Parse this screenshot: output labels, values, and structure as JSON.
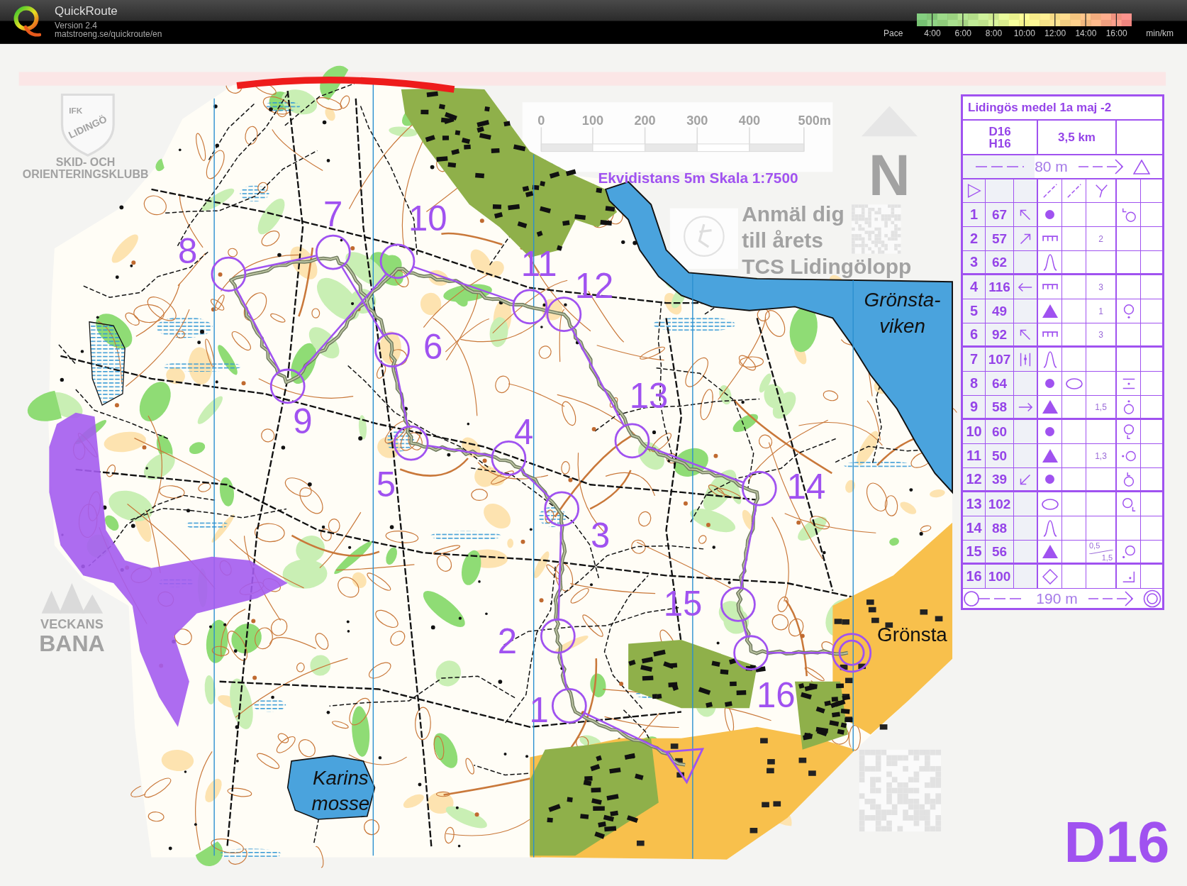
{
  "app_header": {
    "title": "QuickRoute",
    "version": "Version 2.4",
    "url": "matstroeng.se/quickroute/en"
  },
  "pace_legend": {
    "label": "Pace",
    "ticks": [
      "4:00",
      "6:00",
      "8:00",
      "10:00",
      "12:00",
      "14:00",
      "16:00"
    ],
    "unit": "min/km"
  },
  "map": {
    "faded_print": {
      "club_logo": [
        "IFK",
        "LIDINGÖ"
      ],
      "club_name": [
        "SKID- OCH",
        "ORIENTERINGSKLUBB"
      ],
      "scale_bar": [
        "0",
        "100",
        "200",
        "300",
        "400",
        "500m"
      ],
      "north_label": "N",
      "promo": [
        "Anmäl dig",
        "till årets",
        "TCS Lidingölopp"
      ],
      "weekly_course_logo": [
        "VECKANS",
        "BANA"
      ]
    },
    "scale_note": "Ekvidistans 5m Skala 1:7500",
    "place_names": [
      {
        "kind": "water",
        "lines": [
          "Grönsta-",
          "viken"
        ]
      },
      {
        "kind": "settlement",
        "lines": [
          "Grönsta"
        ]
      },
      {
        "kind": "water",
        "lines": [
          "Karins",
          "mosse"
        ]
      }
    ],
    "controls": [
      "1",
      "2",
      "3",
      "4",
      "5",
      "6",
      "7",
      "8",
      "9",
      "10",
      "11",
      "12",
      "13",
      "14",
      "15",
      "16"
    ],
    "class_label": "D16"
  },
  "control_descriptions": {
    "title": "Lidingös medel 1a maj -2",
    "classes": [
      "D16",
      "H16"
    ],
    "length": "3,5 km",
    "start_distance": "80 m",
    "rows": [
      {
        "number": "1",
        "code": "67",
        "direction": {
          "kind": "northwest"
        },
        "feature": {
          "kind": "dot"
        },
        "location": {
          "kind": "nwcorner"
        }
      },
      {
        "number": "2",
        "code": "57",
        "direction": {
          "kind": "northeast"
        },
        "feature": {
          "kind": "cliff"
        },
        "size": "2"
      },
      {
        "number": "3",
        "code": "62",
        "feature": {
          "kind": "hill"
        }
      },
      {
        "number": "4",
        "code": "116",
        "direction": {
          "kind": "west"
        },
        "feature": {
          "kind": "cliff"
        },
        "size": "3"
      },
      {
        "number": "5",
        "code": "49",
        "feature": {
          "kind": "triangle"
        },
        "size": "1",
        "location": {
          "kind": "south"
        }
      },
      {
        "number": "6",
        "code": "92",
        "direction": {
          "kind": "northwest"
        },
        "feature": {
          "kind": "cliff"
        },
        "size": "3"
      },
      {
        "number": "7",
        "code": "107",
        "direction": {
          "kind": "between"
        },
        "feature": {
          "kind": "hill"
        }
      },
      {
        "number": "8",
        "code": "64",
        "feature": {
          "kind": "dot"
        },
        "appearance": {
          "kind": "oval"
        },
        "location": {
          "kind": "between"
        }
      },
      {
        "number": "9",
        "code": "58",
        "direction": {
          "kind": "east"
        },
        "feature": {
          "kind": "triangle"
        },
        "size": "1,5",
        "location": {
          "kind": "north"
        }
      },
      {
        "number": "10",
        "code": "60",
        "feature": {
          "kind": "dot"
        },
        "location": {
          "kind": "foot"
        }
      },
      {
        "number": "11",
        "code": "50",
        "feature": {
          "kind": "triangle"
        },
        "size": "1,3",
        "location": {
          "kind": "west"
        }
      },
      {
        "number": "12",
        "code": "39",
        "direction": {
          "kind": "southwest"
        },
        "feature": {
          "kind": "dot"
        },
        "location": {
          "kind": "footabove"
        }
      },
      {
        "number": "13",
        "code": "102",
        "feature": {
          "kind": "oval"
        },
        "location": {
          "kind": "southeastfoot"
        }
      },
      {
        "number": "14",
        "code": "88",
        "feature": {
          "kind": "hill"
        }
      },
      {
        "number": "15",
        "code": "56",
        "feature": {
          "kind": "triangle"
        },
        "size_pair": [
          "0,5",
          "1,5"
        ],
        "location": {
          "kind": "southwest"
        }
      },
      {
        "number": "16",
        "code": "100",
        "feature": {
          "kind": "diamond"
        },
        "location": {
          "kind": "corner"
        }
      }
    ],
    "finish_distance": "190 m"
  }
}
